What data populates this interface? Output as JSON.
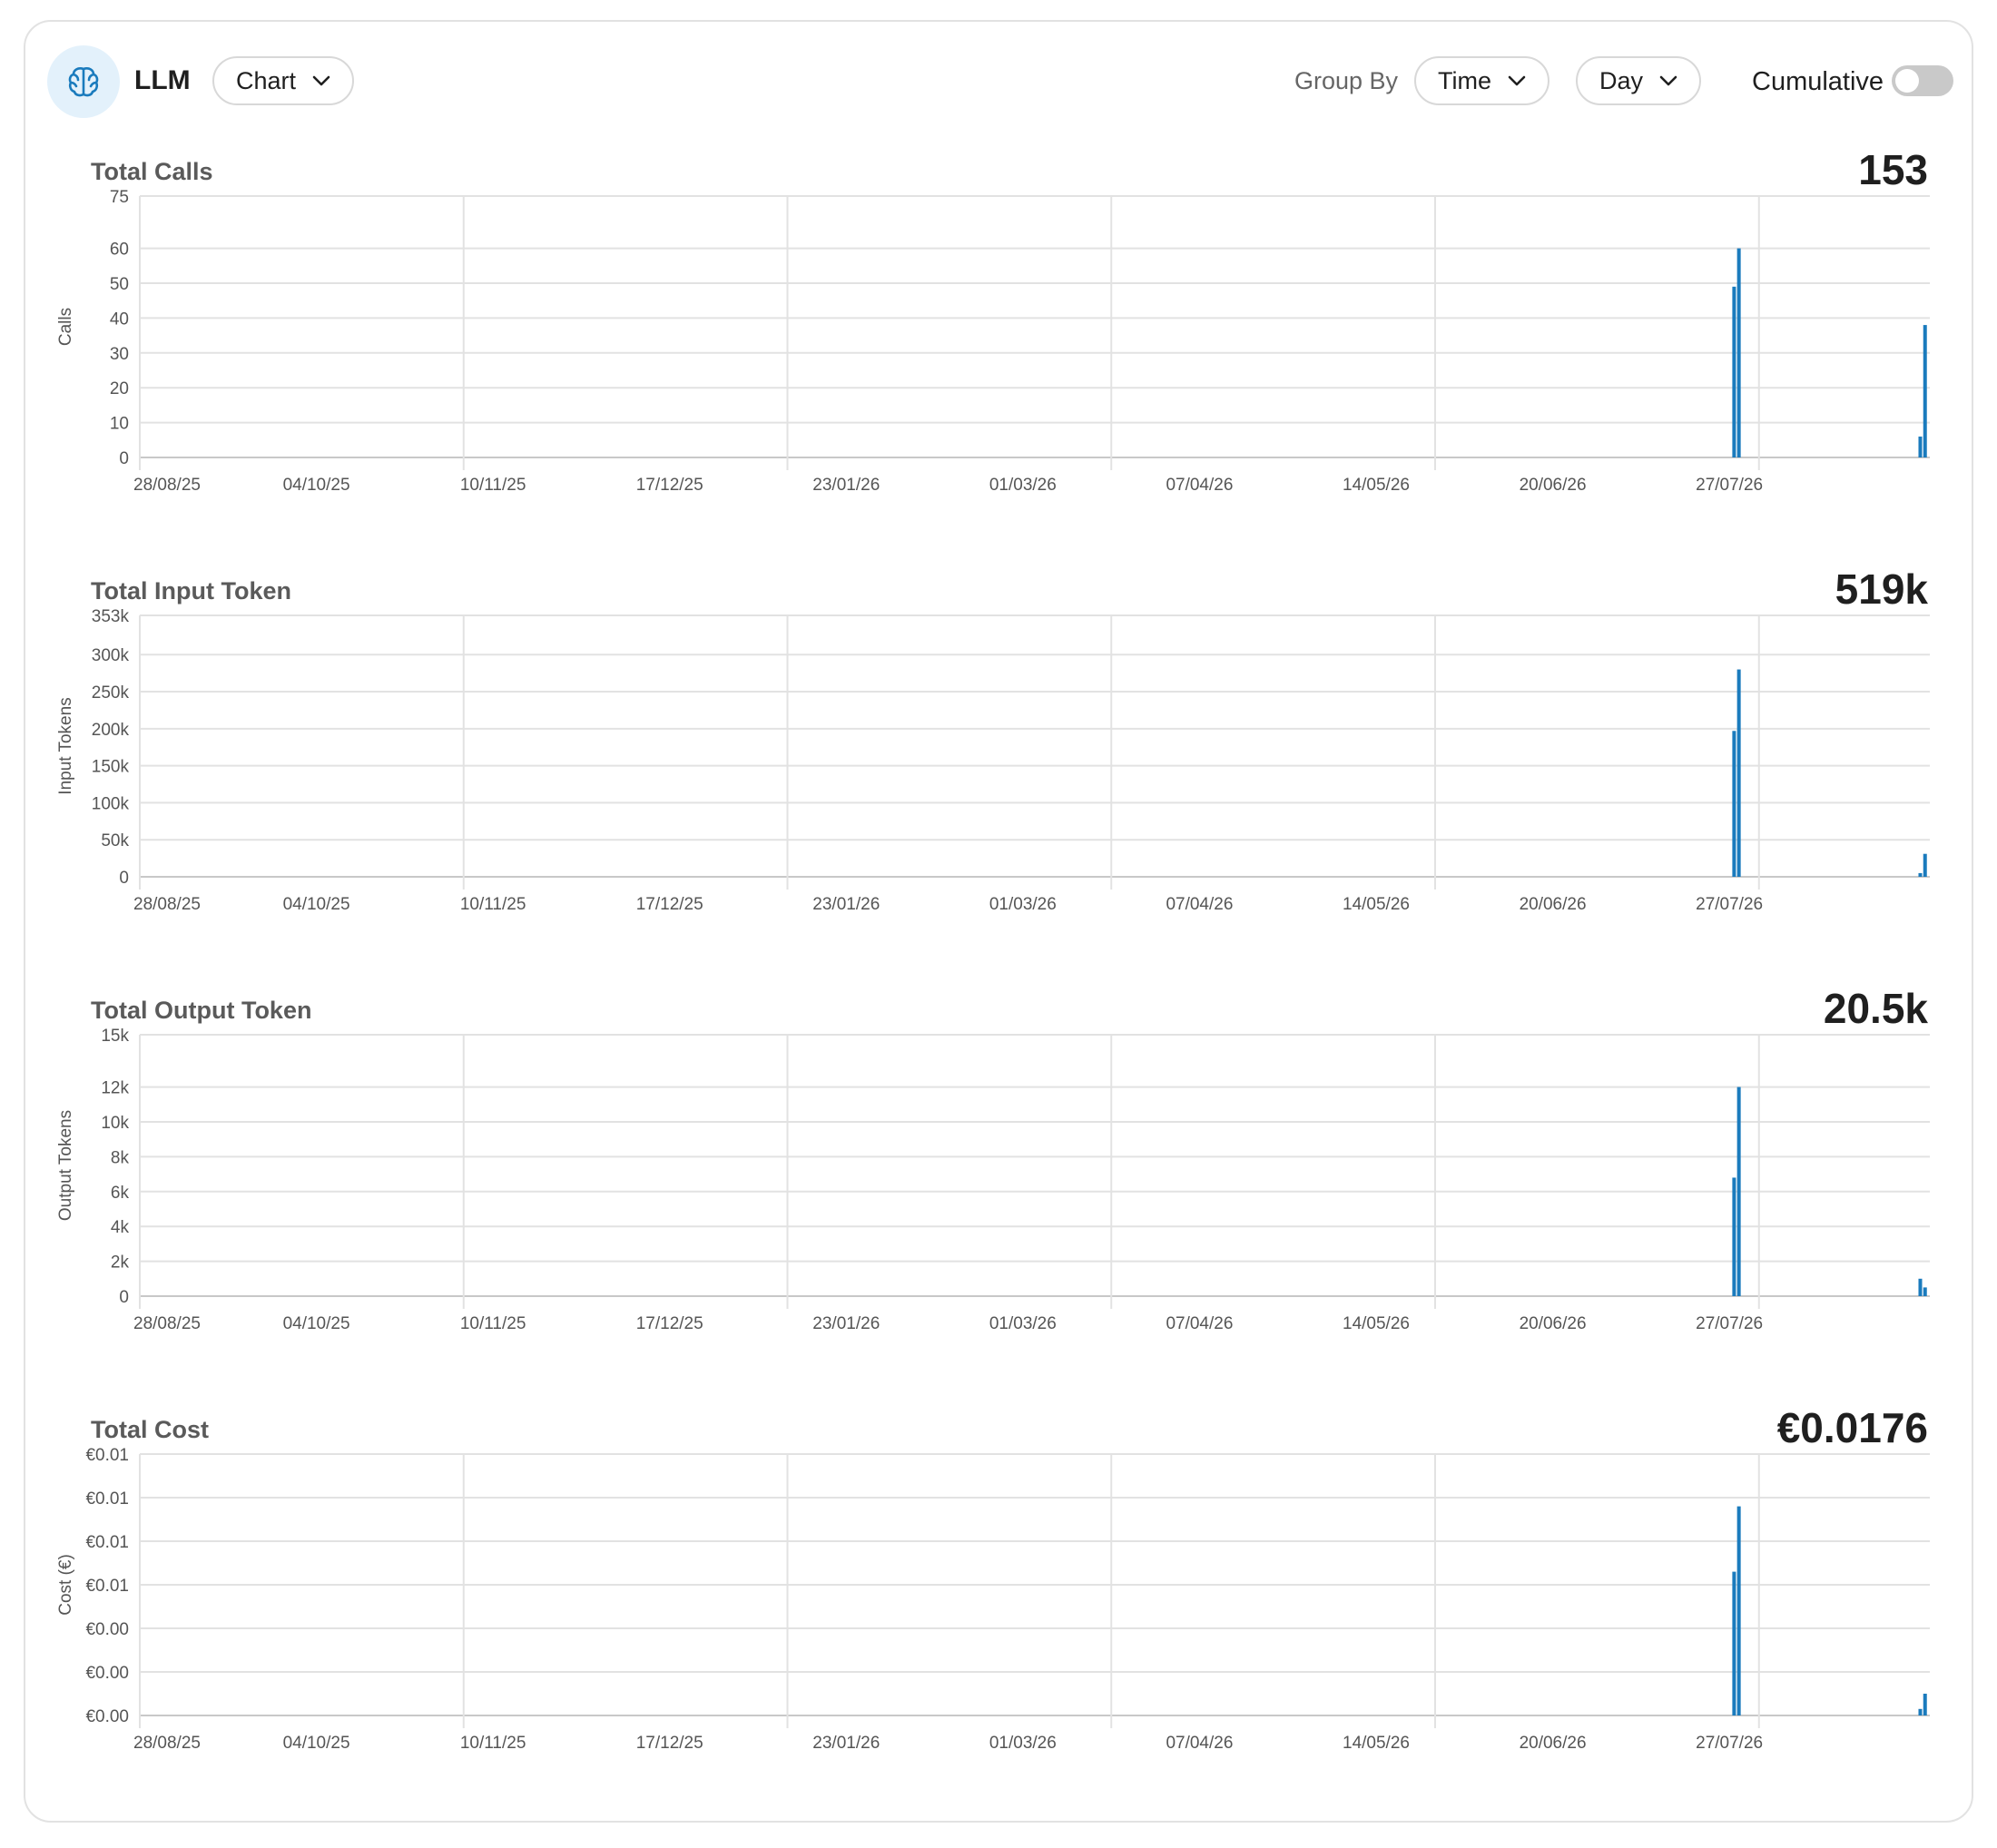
{
  "header": {
    "app_name": "LLM",
    "icon": "brain-icon",
    "view_select": "Chart",
    "group_by_label": "Group By",
    "group_by_value": "Time",
    "interval_value": "Day",
    "cumulative_label": "Cumulative",
    "cumulative_on": false
  },
  "colors": {
    "bar": "#1a7bbd",
    "grid": "#e2e2e2",
    "accent_bg": "#e3f1fb"
  },
  "panels": [
    {
      "title": "Total Calls",
      "total": "153"
    },
    {
      "title": "Total Input Token",
      "total": "519k"
    },
    {
      "title": "Total Output Token",
      "total": "20.5k"
    },
    {
      "title": "Total Cost",
      "total": "€0.0176"
    }
  ],
  "chart_data": [
    {
      "type": "bar",
      "title": "Total Calls",
      "xlabel": "",
      "ylabel": "Calls",
      "x_start": "2025-08-28",
      "x_end": "2026-09-07",
      "x_tick_labels": [
        "28/08/25",
        "04/10/25",
        "10/11/25",
        "17/12/25",
        "23/01/26",
        "01/03/26",
        "07/04/26",
        "14/05/26",
        "20/06/26",
        "27/07/26"
      ],
      "y_ticks": [
        0,
        10,
        20,
        30,
        40,
        50,
        60,
        75
      ],
      "y_tick_labels": [
        "0",
        "10",
        "20",
        "30",
        "40",
        "50",
        "60",
        "75"
      ],
      "ylim": [
        0,
        75
      ],
      "grid": true,
      "bars": [
        {
          "date": "2026-07-28",
          "value": 49
        },
        {
          "date": "2026-07-29",
          "value": 60
        },
        {
          "date": "2026-09-05",
          "value": 6
        },
        {
          "date": "2026-09-06",
          "value": 38
        }
      ]
    },
    {
      "type": "bar",
      "title": "Total Input Token",
      "xlabel": "",
      "ylabel": "Input Tokens",
      "x_start": "2025-08-28",
      "x_end": "2026-09-07",
      "x_tick_labels": [
        "28/08/25",
        "04/10/25",
        "10/11/25",
        "17/12/25",
        "23/01/26",
        "01/03/26",
        "07/04/26",
        "14/05/26",
        "20/06/26",
        "27/07/26"
      ],
      "y_ticks": [
        0,
        50000,
        100000,
        150000,
        200000,
        250000,
        300000,
        353000
      ],
      "y_tick_labels": [
        "0",
        "50k",
        "100k",
        "150k",
        "200k",
        "250k",
        "300k",
        "353k"
      ],
      "ylim": [
        0,
        353000
      ],
      "grid": true,
      "bars": [
        {
          "date": "2026-07-28",
          "value": 197000
        },
        {
          "date": "2026-07-29",
          "value": 280000
        },
        {
          "date": "2026-09-05",
          "value": 5000
        },
        {
          "date": "2026-09-06",
          "value": 31000
        }
      ]
    },
    {
      "type": "bar",
      "title": "Total Output Token",
      "xlabel": "",
      "ylabel": "Output Tokens",
      "x_start": "2025-08-28",
      "x_end": "2026-09-07",
      "x_tick_labels": [
        "28/08/25",
        "04/10/25",
        "10/11/25",
        "17/12/25",
        "23/01/26",
        "01/03/26",
        "07/04/26",
        "14/05/26",
        "20/06/26",
        "27/07/26"
      ],
      "y_ticks": [
        0,
        2000,
        4000,
        6000,
        8000,
        10000,
        12000,
        15000
      ],
      "y_tick_labels": [
        "0",
        "2k",
        "4k",
        "6k",
        "8k",
        "10k",
        "12k",
        "15k"
      ],
      "ylim": [
        0,
        15000
      ],
      "grid": true,
      "bars": [
        {
          "date": "2026-07-28",
          "value": 6800
        },
        {
          "date": "2026-07-29",
          "value": 12000
        },
        {
          "date": "2026-09-05",
          "value": 1000
        },
        {
          "date": "2026-09-06",
          "value": 500
        }
      ]
    },
    {
      "type": "bar",
      "title": "Total Cost",
      "xlabel": "",
      "ylabel": "Cost (€)",
      "x_start": "2025-08-28",
      "x_end": "2026-09-07",
      "x_tick_labels": [
        "28/08/25",
        "04/10/25",
        "10/11/25",
        "17/12/25",
        "23/01/26",
        "01/03/26",
        "07/04/26",
        "14/05/26",
        "20/06/26",
        "27/07/26"
      ],
      "y_ticks": [
        0,
        0.002,
        0.004,
        0.006,
        0.008,
        0.01,
        0.012
      ],
      "y_tick_labels": [
        "€0.00",
        "€0.00",
        "€0.00",
        "€0.01",
        "€0.01",
        "€0.01",
        "€0.01"
      ],
      "ylim": [
        0,
        0.012
      ],
      "grid": true,
      "bars": [
        {
          "date": "2026-07-28",
          "value": 0.0066
        },
        {
          "date": "2026-07-29",
          "value": 0.0096
        },
        {
          "date": "2026-09-05",
          "value": 0.0003
        },
        {
          "date": "2026-09-06",
          "value": 0.001
        }
      ]
    }
  ]
}
